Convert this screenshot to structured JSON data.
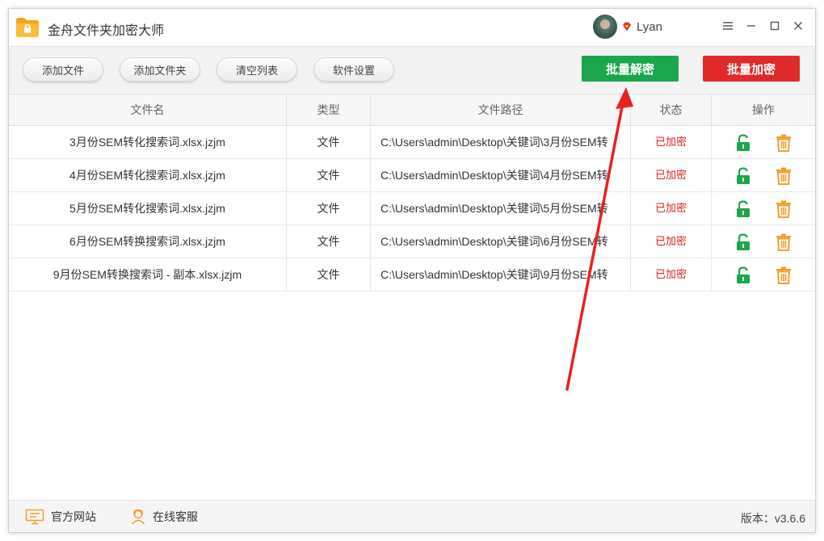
{
  "app": {
    "title": "金舟文件夹加密大师"
  },
  "user": {
    "name": "Lyan"
  },
  "toolbar": {
    "add_file": "添加文件",
    "add_folder": "添加文件夹",
    "clear_list": "清空列表",
    "settings": "软件设置",
    "batch_decrypt": "批量解密",
    "batch_encrypt": "批量加密"
  },
  "table": {
    "headers": [
      "文件名",
      "类型",
      "文件路径",
      "状态",
      "操作"
    ],
    "rows": [
      {
        "name": "3月份SEM转化搜索词.xlsx.jzjm",
        "type": "文件",
        "path": "C:\\Users\\admin\\Desktop\\关键词\\3月份SEM转",
        "status": "已加密"
      },
      {
        "name": "4月份SEM转化搜索词.xlsx.jzjm",
        "type": "文件",
        "path": "C:\\Users\\admin\\Desktop\\关键词\\4月份SEM转",
        "status": "已加密"
      },
      {
        "name": "5月份SEM转化搜索词.xlsx.jzjm",
        "type": "文件",
        "path": "C:\\Users\\admin\\Desktop\\关键词\\5月份SEM转",
        "status": "已加密"
      },
      {
        "name": "6月份SEM转换搜索词.xlsx.jzjm",
        "type": "文件",
        "path": "C:\\Users\\admin\\Desktop\\关键词\\6月份SEM转",
        "status": "已加密"
      },
      {
        "name": "9月份SEM转换搜索词 - 副本.xlsx.jzjm",
        "type": "文件",
        "path": "C:\\Users\\admin\\Desktop\\关键词\\9月份SEM转",
        "status": "已加密"
      }
    ]
  },
  "footer": {
    "website": "官方网站",
    "support": "在线客服",
    "version": "版本：v3.6.6"
  },
  "colors": {
    "decrypt_green": "#1aa64a",
    "encrypt_red": "#e02a2a",
    "status_red": "#e02020",
    "unlock_icon": "#1aa64a",
    "delete_icon": "#f0a030",
    "arrow": "#e8231f"
  },
  "icons": {
    "logo": "folder-lock-icon",
    "vip": "vip-diamond-icon",
    "menu": "menu-icon",
    "minimize": "minimize-icon",
    "maximize": "maximize-icon",
    "close": "close-icon",
    "unlock": "unlock-icon",
    "delete": "trash-icon",
    "website": "monitor-icon",
    "support": "headset-person-icon"
  }
}
